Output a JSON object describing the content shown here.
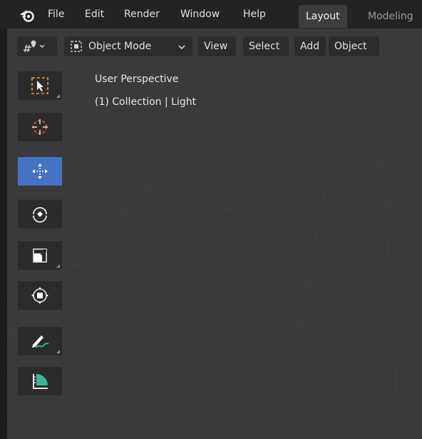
{
  "menubar": {
    "items": [
      "File",
      "Edit",
      "Render",
      "Window",
      "Help"
    ],
    "workspace_tabs": [
      "Layout",
      "Modeling"
    ],
    "active_tab": "Layout"
  },
  "viewport_header": {
    "mode_label": "Object Mode",
    "menus": [
      "View",
      "Select",
      "Add",
      "Object"
    ]
  },
  "viewport": {
    "view_name": "User Perspective",
    "collection_info": "(1) Collection | Light"
  },
  "toolbar": {
    "tools": [
      {
        "name": "select-box-icon"
      },
      {
        "name": "cursor-icon"
      },
      {
        "name": "move-icon",
        "active": true
      },
      {
        "name": "rotate-icon"
      },
      {
        "name": "scale-icon"
      },
      {
        "name": "transform-icon"
      },
      {
        "name": "annotate-icon"
      },
      {
        "name": "measure-icon"
      }
    ]
  },
  "colors": {
    "active_tool": "#4672c4",
    "viewport_bg": "#3a3a3a",
    "panel_bg": "#2b2b2b"
  }
}
